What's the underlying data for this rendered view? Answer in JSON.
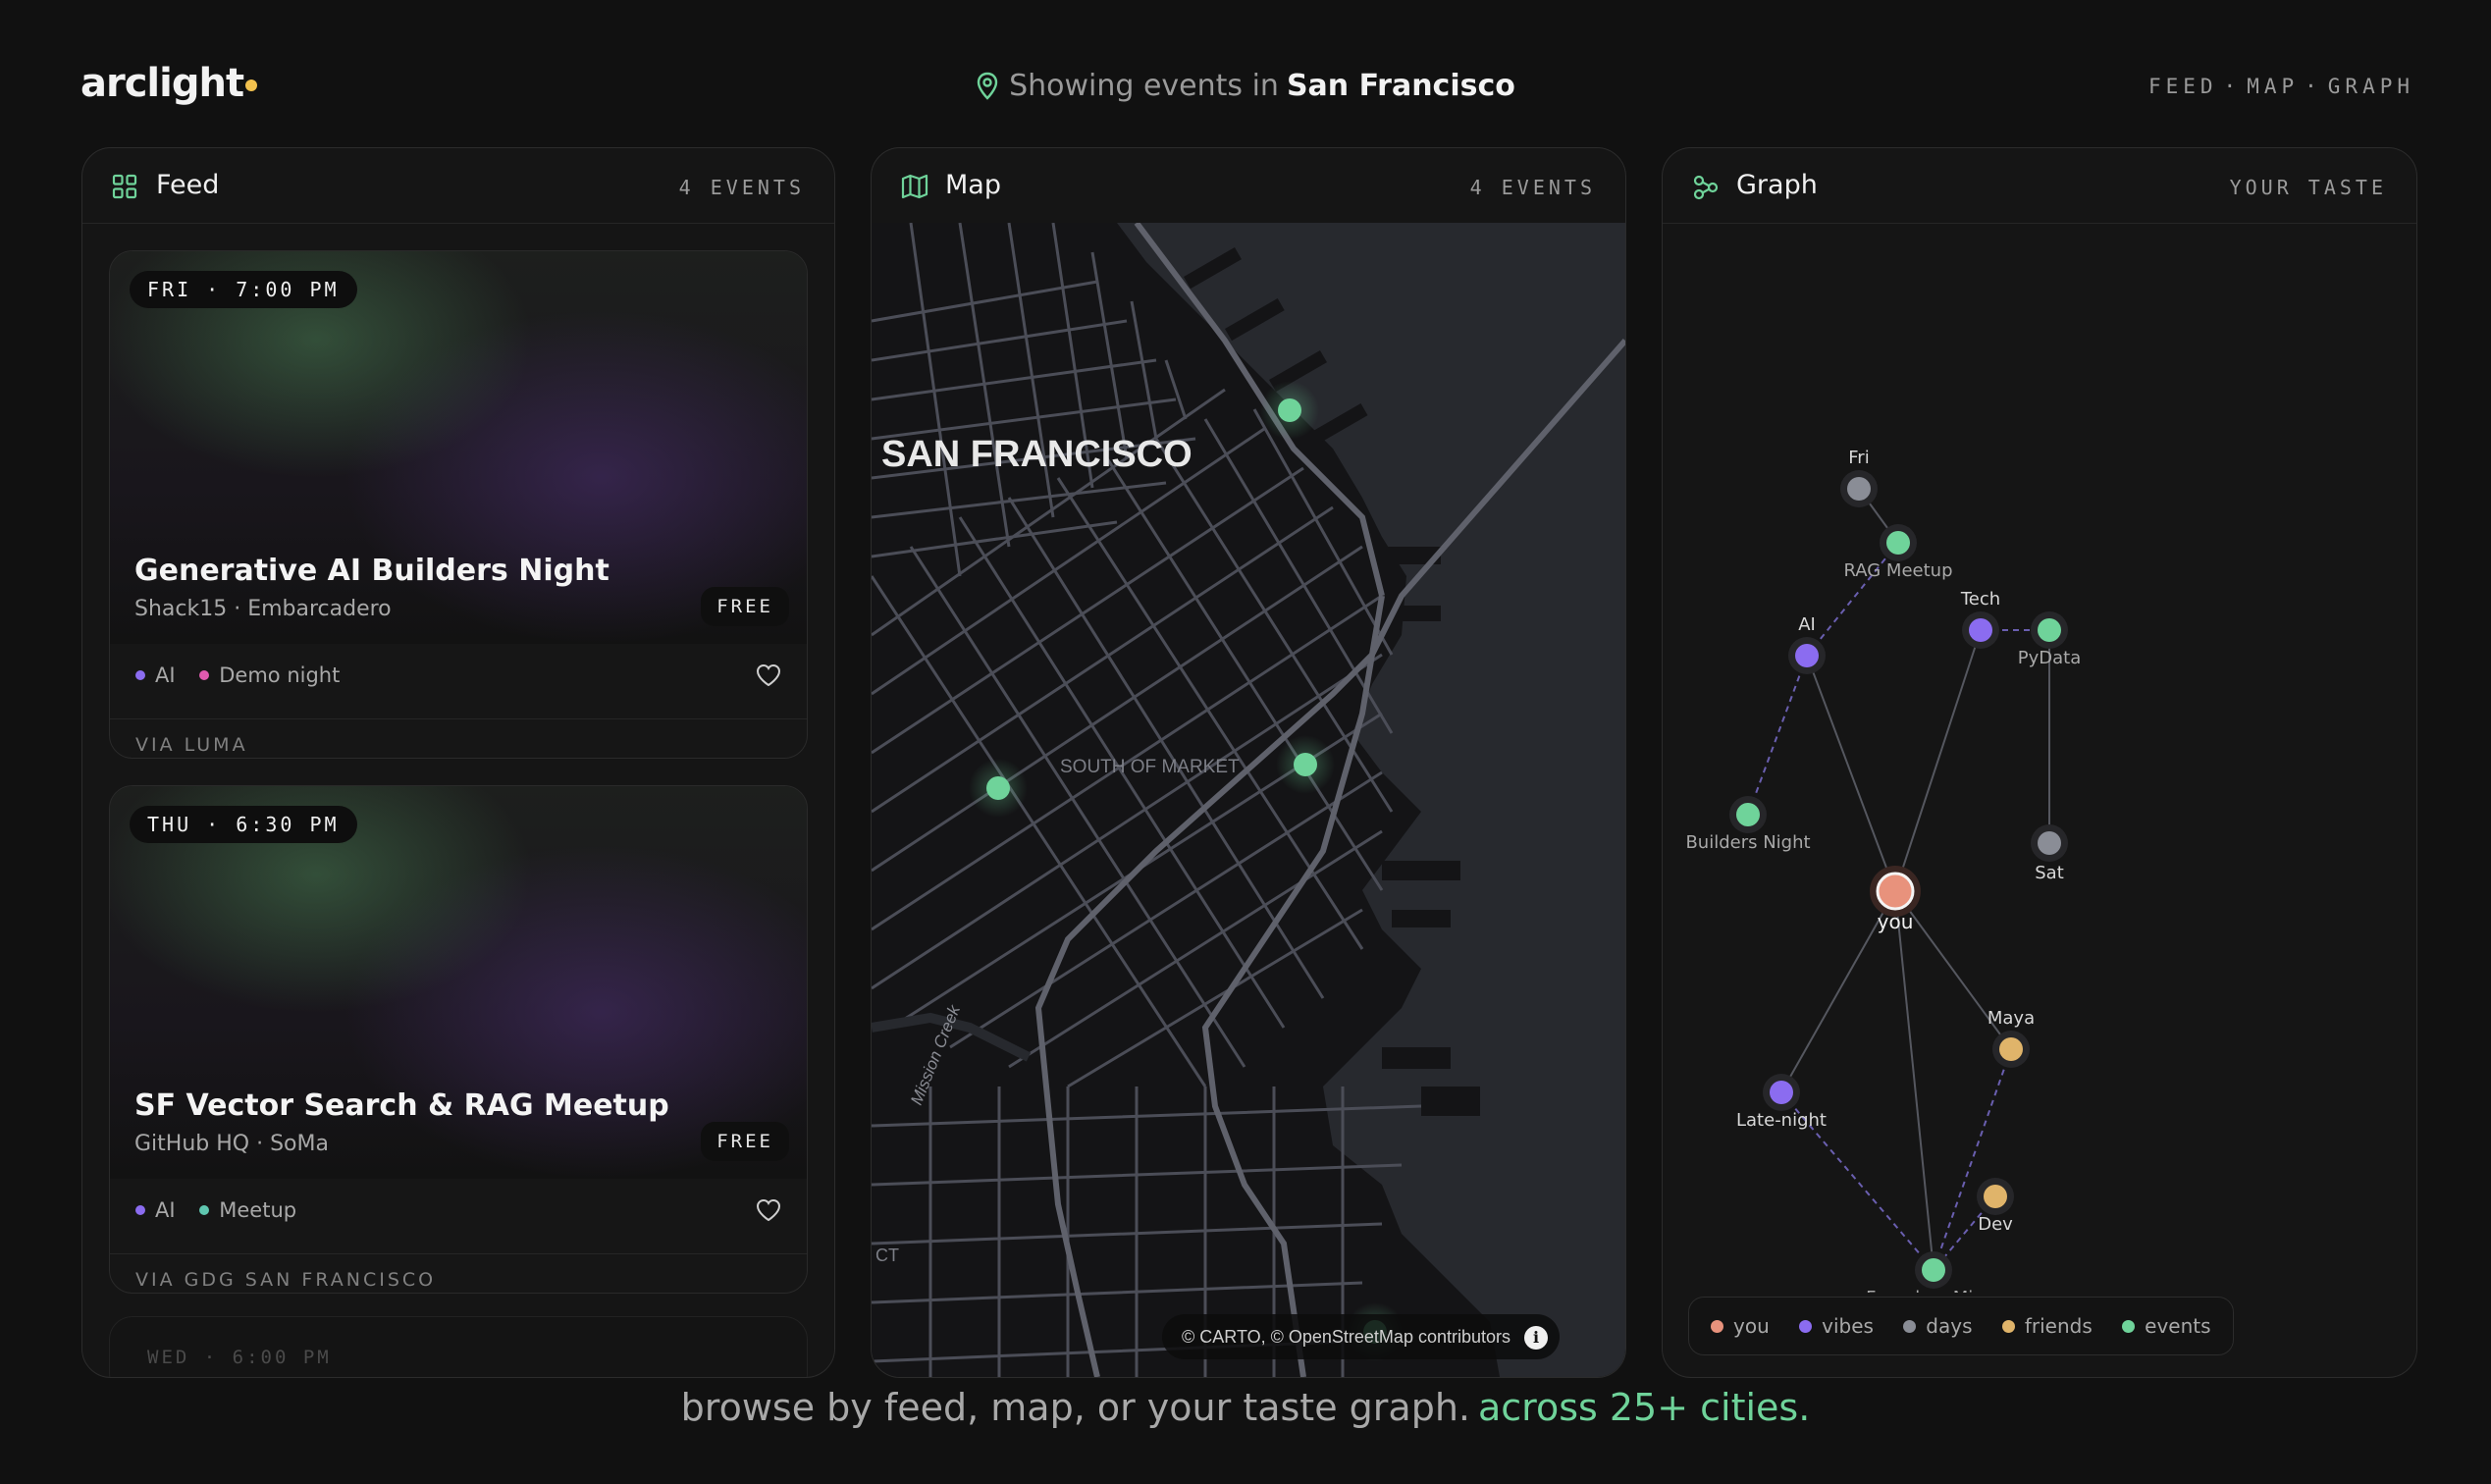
{
  "app": {
    "logo_text": "arclight",
    "accent": "#f2c14e"
  },
  "location": {
    "prefix": "Showing events in",
    "city": "San Francisco"
  },
  "nav": {
    "items": [
      "FEED",
      "MAP",
      "GRAPH"
    ],
    "separator": "·"
  },
  "feed": {
    "title": "Feed",
    "count_label": "4 EVENTS",
    "cards": [
      {
        "time": "FRI · 7:00 PM",
        "title": "Generative AI Builders Night",
        "venue": "Shack15 · Embarcadero",
        "price": "FREE",
        "tags": [
          {
            "label": "AI",
            "color": "#8b6cf0"
          },
          {
            "label": "Demo night",
            "color": "#e05ab0"
          }
        ],
        "source": "VIA LUMA"
      },
      {
        "time": "THU · 6:30 PM",
        "title": "SF Vector Search & RAG Meetup",
        "venue": "GitHub HQ · SoMa",
        "price": "FREE",
        "tags": [
          {
            "label": "AI",
            "color": "#8b6cf0"
          },
          {
            "label": "Meetup",
            "color": "#5fc7b0"
          }
        ],
        "source": "VIA GDG SAN FRANCISCO"
      }
    ],
    "next_card_time": "WED · 6:00 PM"
  },
  "map": {
    "title": "Map",
    "count_label": "4 EVENTS",
    "city_label": "SAN FRANCISCO",
    "district_label": "SOUTH OF MARKET",
    "creek_label": "Mission Creek",
    "corner_label": "CT",
    "attribution": "© CARTO, © OpenStreetMap contributors",
    "marker_color": "#6fd39a"
  },
  "graph": {
    "title": "Graph",
    "right_label": "YOUR TASTE",
    "nodes": [
      {
        "id": "you",
        "label": "you",
        "kind": "you"
      },
      {
        "id": "ai",
        "label": "AI",
        "kind": "vibes"
      },
      {
        "id": "tech",
        "label": "Tech",
        "kind": "vibes"
      },
      {
        "id": "latenight",
        "label": "Late-night",
        "kind": "vibes"
      },
      {
        "id": "fri",
        "label": "Fri",
        "kind": "days"
      },
      {
        "id": "sat",
        "label": "Sat",
        "kind": "days"
      },
      {
        "id": "maya",
        "label": "Maya",
        "kind": "friends"
      },
      {
        "id": "dev",
        "label": "Dev",
        "kind": "friends"
      },
      {
        "id": "rag",
        "label": "RAG Meetup",
        "kind": "events"
      },
      {
        "id": "builders",
        "label": "Builders Night",
        "kind": "events"
      },
      {
        "id": "pydata",
        "label": "PyData",
        "kind": "events"
      },
      {
        "id": "founders",
        "label": "Founders Mixer",
        "kind": "events"
      }
    ],
    "edges": [
      [
        "you",
        "ai"
      ],
      [
        "you",
        "tech"
      ],
      [
        "you",
        "latenight"
      ],
      [
        "you",
        "maya"
      ],
      [
        "you",
        "founders"
      ],
      [
        "fri",
        "rag"
      ],
      [
        "pydata",
        "sat"
      ]
    ],
    "dashed_edges": [
      [
        "ai",
        "rag"
      ],
      [
        "ai",
        "builders"
      ],
      [
        "tech",
        "pydata"
      ],
      [
        "latenight",
        "founders"
      ],
      [
        "maya",
        "founders"
      ],
      [
        "dev",
        "founders"
      ]
    ],
    "legend": [
      {
        "label": "you",
        "color": "#e8927c"
      },
      {
        "label": "vibes",
        "color": "#8b6cf0"
      },
      {
        "label": "days",
        "color": "#8a8d96"
      },
      {
        "label": "friends",
        "color": "#e0b46a"
      },
      {
        "label": "events",
        "color": "#6fd39a"
      }
    ]
  },
  "tagline": {
    "main": "browse by feed, map, or your taste graph.",
    "highlight": "across 25+ cities."
  }
}
